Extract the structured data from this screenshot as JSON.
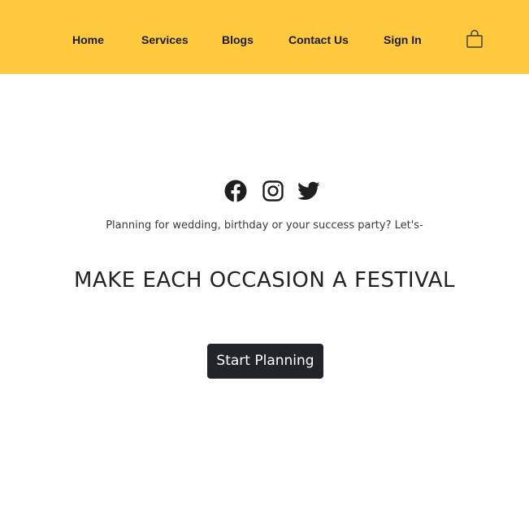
{
  "nav": {
    "items": [
      {
        "label": "Home"
      },
      {
        "label": "Services"
      },
      {
        "label": "Blogs"
      },
      {
        "label": "Contact Us"
      },
      {
        "label": "Sign In"
      }
    ],
    "cart_icon": "shopping-bag-icon",
    "background": "#ffc93e"
  },
  "socials": {
    "icons": [
      "facebook-icon",
      "instagram-icon",
      "twitter-icon"
    ],
    "color": "#1f1f1f"
  },
  "hero": {
    "tagline": "Planning for wedding, birthday or your success party? Let's-",
    "headline": "MAKE EACH OCCASION A FESTIVAL",
    "cta_label": "Start Planning",
    "cta_color": "#212529"
  }
}
